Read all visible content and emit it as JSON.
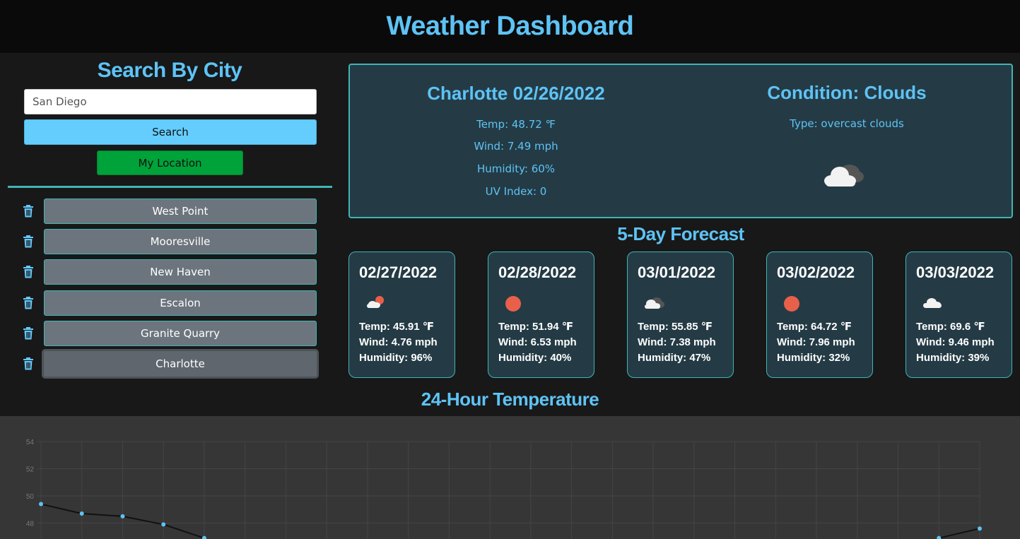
{
  "header": {
    "title": "Weather Dashboard"
  },
  "search": {
    "title": "Search By City",
    "input_value": "San Diego",
    "search_label": "Search",
    "location_label": "My Location"
  },
  "history": [
    {
      "label": "West Point",
      "active": false
    },
    {
      "label": "Mooresville",
      "active": false
    },
    {
      "label": "New Haven",
      "active": false
    },
    {
      "label": "Escalon",
      "active": false
    },
    {
      "label": "Granite Quarry",
      "active": false
    },
    {
      "label": "Charlotte",
      "active": true
    }
  ],
  "current": {
    "city_date": "Charlotte 02/26/2022",
    "temp": "Temp: 48.72 ℉",
    "wind": "Wind: 7.49 mph",
    "humidity": "Humidity: 60%",
    "uv": "UV Index: 0",
    "condition": "Condition: Clouds",
    "type": "Type: overcast clouds",
    "icon": "overcast-clouds-icon"
  },
  "forecast": {
    "title": "5-Day Forecast",
    "days": [
      {
        "date": "02/27/2022",
        "icon": "few-clouds-sun-icon",
        "temp": "Temp: 45.91 ℉",
        "wind": "Wind: 4.76 mph",
        "humidity": "Humidity: 96%"
      },
      {
        "date": "02/28/2022",
        "icon": "sun-icon",
        "temp": "Temp: 51.94 ℉",
        "wind": "Wind: 6.53 mph",
        "humidity": "Humidity: 40%"
      },
      {
        "date": "03/01/2022",
        "icon": "broken-clouds-icon",
        "temp": "Temp: 55.85 ℉",
        "wind": "Wind: 7.38 mph",
        "humidity": "Humidity: 47%"
      },
      {
        "date": "03/02/2022",
        "icon": "sun-icon",
        "temp": "Temp: 64.72 ℉",
        "wind": "Wind: 7.96 mph",
        "humidity": "Humidity: 32%"
      },
      {
        "date": "03/03/2022",
        "icon": "cloud-icon",
        "temp": "Temp: 69.6 ℉",
        "wind": "Wind: 9.46 mph",
        "humidity": "Humidity: 39%"
      }
    ]
  },
  "chart_data": {
    "type": "line",
    "title": "24-Hour Temperature",
    "y_ticks": [
      "54",
      "52",
      "50",
      "48"
    ],
    "ylim_visible": [
      47.0,
      54.0
    ],
    "grid": true,
    "x_count": 24,
    "series": [
      {
        "values": [
          49.4,
          48.7,
          48.5,
          47.9,
          46.9,
          null,
          null,
          null,
          null,
          null,
          null,
          null,
          null,
          null,
          null,
          null,
          null,
          null,
          null,
          null,
          null,
          null,
          46.9,
          47.6
        ]
      }
    ]
  },
  "colors": {
    "accent": "#5ec3f5",
    "card_bg": "#243b45",
    "card_border": "#3fb5b5",
    "location_btn": "#00a23a",
    "history_btn": "#6c757d",
    "sun": "#e8604a"
  }
}
